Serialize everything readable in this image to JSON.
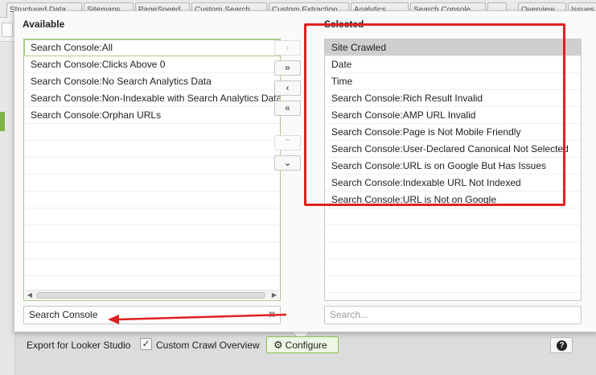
{
  "available": {
    "heading": "Available",
    "items": [
      "Search Console:All",
      "Search Console:Clicks Above 0",
      "Search Console:No Search Analytics Data",
      "Search Console:Non-Indexable with Search Analytics Data",
      "Search Console:Orphan URLs"
    ],
    "filter_value": "Search Console",
    "clear_glyph": "✖"
  },
  "selected": {
    "heading": "Selected",
    "items": [
      "Site Crawled",
      "Date",
      "Time",
      "Search Console:Rich Result Invalid",
      "Search Console:AMP URL Invalid",
      "Search Console:Page is Not Mobile Friendly",
      "Search Console:User-Declared Canonical Not Selected",
      "Search Console:URL is on Google But Has Issues",
      "Search Console:Indexable URL Not Indexed",
      "Search Console:URL is Not on Google"
    ],
    "filter_placeholder": "Search..."
  },
  "move_buttons": {
    "add_one": "›",
    "add_all": "»",
    "remove_one": "‹",
    "remove_all": "«",
    "move_up": "⌃",
    "move_down": "⌄"
  },
  "bottom_bar": {
    "export_label": "Export for Looker Studio",
    "checkbox_mark": "✓",
    "custom_crawl_label": "Custom Crawl Overview",
    "configure_label": "Configure",
    "help_glyph": "?"
  },
  "background_tabs": [
    "Structured Data",
    "Sitemaps",
    "PageSpeed",
    "Custom Search",
    "Custom Extraction",
    "Analytics",
    "Search Console",
    "",
    "Overview",
    "Issues"
  ],
  "colors": {
    "accent_green": "#8dbf5a",
    "annotation_red": "#e02020",
    "selected_row": "#cfcfcf"
  }
}
